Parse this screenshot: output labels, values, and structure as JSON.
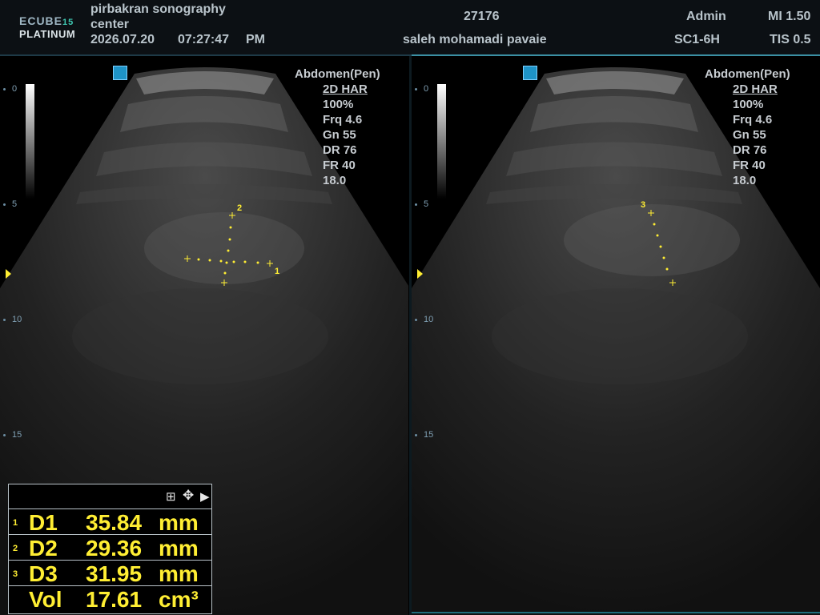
{
  "header": {
    "logo_line1": "ECUBE",
    "logo_model": "15",
    "logo_line2": "PLATINUM",
    "clinic_line1": "pirbakran sonography",
    "clinic_line2": "center",
    "date": "2026.07.20",
    "time": "07:27:47",
    "ampm": "PM",
    "patient_id": "27176",
    "patient_name": "saleh mohamadi pavaie",
    "user": "Admin",
    "probe": "SC1-6H",
    "mi": "MI 1.50",
    "tis": "TIS 0.5"
  },
  "left_pane": {
    "preset": "Abdomen(Pen)",
    "mode": "2D HAR",
    "power": "100%",
    "frq": "Frq 4.6",
    "gain": "Gn 55",
    "dr": "DR 76",
    "fr": "FR 40",
    "depth": "18.0",
    "depth_marks": [
      "0",
      "5",
      "10",
      "15"
    ],
    "caliper_labels": [
      "1",
      "2"
    ]
  },
  "right_pane": {
    "preset": "Abdomen(Pen)",
    "mode": "2D HAR",
    "power": "100%",
    "frq": "Frq 4.6",
    "gain": "Gn 55",
    "dr": "DR 76",
    "fr": "FR 40",
    "depth": "18.0",
    "depth_marks": [
      "0",
      "5",
      "10",
      "15"
    ],
    "caliper_labels": [
      "3"
    ]
  },
  "measurements": [
    {
      "idx": "1",
      "label": "D1",
      "value": "35.84",
      "unit": "mm"
    },
    {
      "idx": "2",
      "label": "D2",
      "value": "29.36",
      "unit": "mm"
    },
    {
      "idx": "3",
      "label": "D3",
      "value": "31.95",
      "unit": "mm"
    },
    {
      "idx": "",
      "label": "Vol",
      "value": "17.61",
      "unit": "cm³"
    }
  ],
  "toolbar_icons": [
    "grid-icon",
    "move-icon",
    "arrow-right-icon"
  ],
  "colors": {
    "caliper": "#ffee33",
    "accent": "#3fc9b3"
  }
}
